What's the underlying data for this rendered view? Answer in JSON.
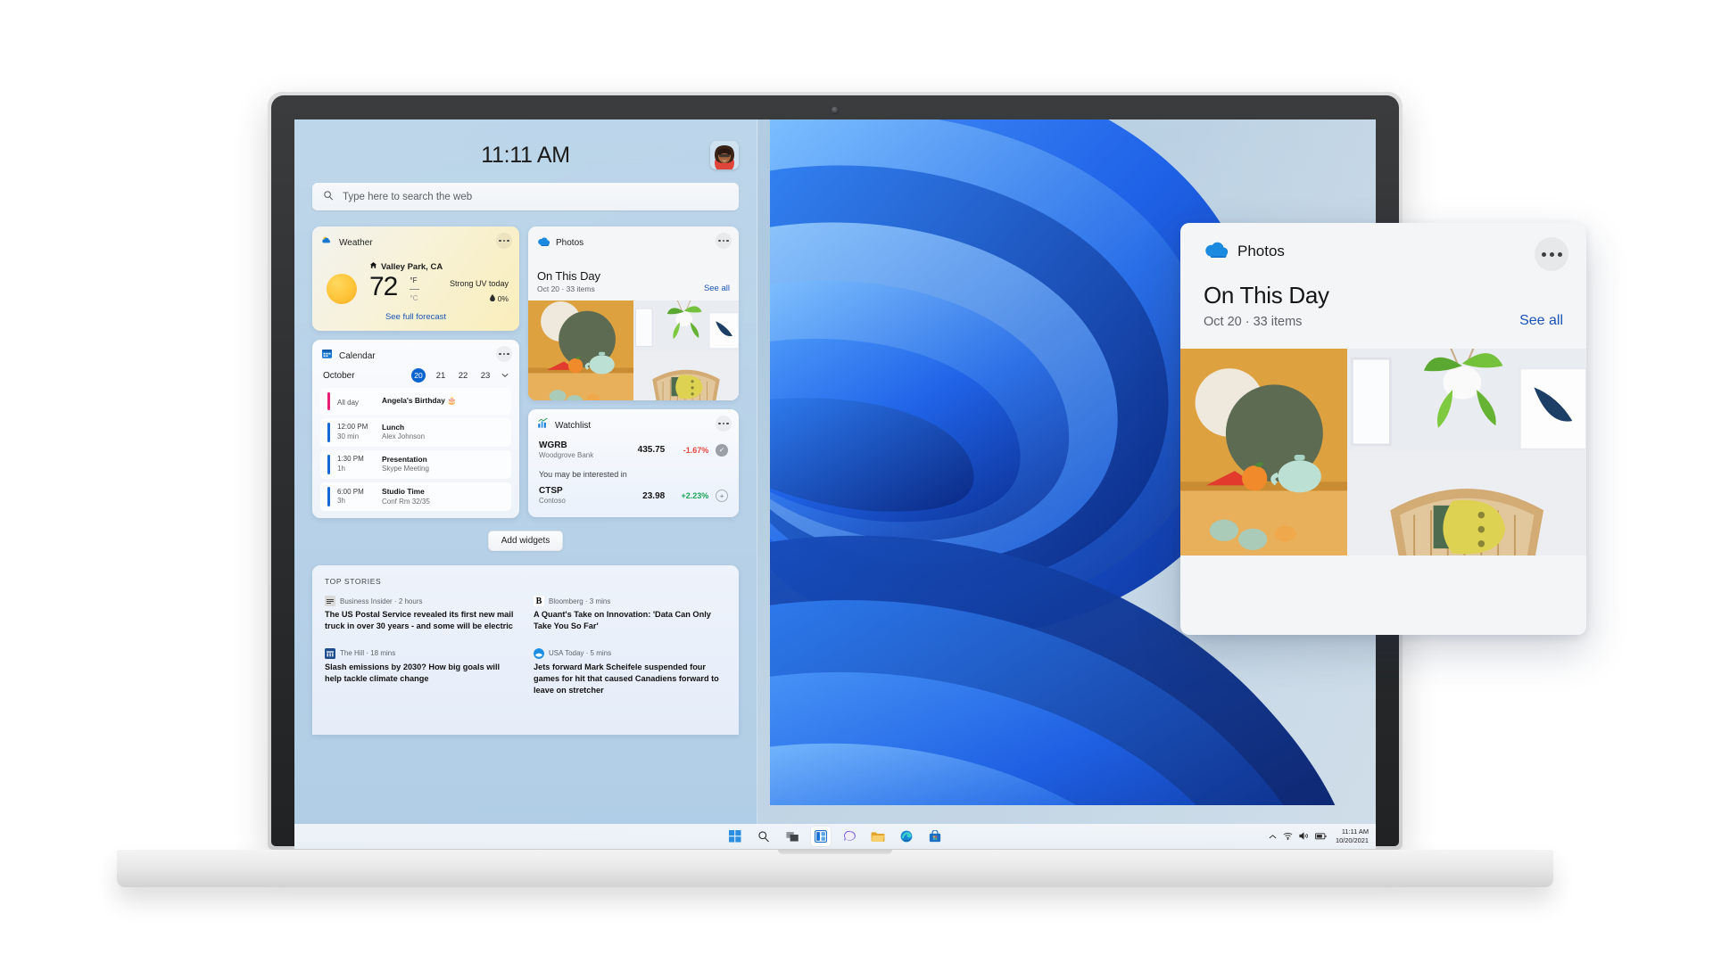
{
  "device": {
    "type": "laptop",
    "webcam": "webcam-dot"
  },
  "widgets_board": {
    "clock": "11:11 AM",
    "avatar_name": "user-avatar",
    "search": {
      "placeholder": "Type here to search the web",
      "icon": "search-icon"
    },
    "add_widgets_label": "Add widgets",
    "weather": {
      "title": "Weather",
      "icon": "partly-cloudy-icon",
      "location": "Valley Park, CA",
      "location_icon": "home-icon",
      "temperature": "72",
      "unit_f": "°F",
      "unit_c": "°C",
      "uv_text": "Strong UV today",
      "precip_icon": "droplet-icon",
      "precip": "0%",
      "link": "See full forecast",
      "more_icon": "more-options-icon"
    },
    "calendar": {
      "title": "Calendar",
      "icon": "calendar-icon",
      "month": "October",
      "days": [
        "20",
        "21",
        "22",
        "23"
      ],
      "selected_day": "20",
      "chevron_icon": "chevron-down-icon",
      "more_icon": "more-options-icon",
      "events": [
        {
          "time": "All day",
          "duration": "",
          "title": "Angela's Birthday",
          "subtitle": "",
          "emoji": "🎂",
          "color": "#e81f76"
        },
        {
          "time": "12:00 PM",
          "duration": "30 min",
          "title": "Lunch",
          "subtitle": "Alex Johnson",
          "emoji": "",
          "color": "#1668d6"
        },
        {
          "time": "1:30 PM",
          "duration": "1h",
          "title": "Presentation",
          "subtitle": "Skype Meeting",
          "emoji": "",
          "color": "#1668d6"
        },
        {
          "time": "6:00 PM",
          "duration": "3h",
          "title": "Studio Time",
          "subtitle": "Conf Rm 32/35",
          "emoji": "",
          "color": "#1668d6"
        }
      ]
    },
    "photos": {
      "title": "Photos",
      "icon": "onedrive-cloud-icon",
      "headline": "On This Day",
      "meta": "Oct 20 · 33 items",
      "see_all": "See all",
      "more_icon": "more-options-icon"
    },
    "watchlist": {
      "title": "Watchlist",
      "icon": "stocks-chart-icon",
      "more_icon": "more-options-icon",
      "note": "You may be interested in",
      "rows": [
        {
          "symbol": "WGRB",
          "company": "Woodgrove Bank",
          "price": "435.75",
          "change": "-1.67%",
          "change_color": "#e8473f",
          "action_icon": "check-icon",
          "action_state": "added"
        },
        {
          "symbol": "CTSP",
          "company": "Contoso",
          "price": "23.98",
          "change": "+2.23%",
          "change_color": "#18a558",
          "action_icon": "plus-icon",
          "action_state": "add"
        }
      ]
    },
    "top_stories": {
      "label": "TOP STORIES",
      "items": [
        {
          "source": "Business Insider",
          "time": "2 hours",
          "logo": "business-insider-logo",
          "logo_bg": "#d8d8d8",
          "logo_text": "BI",
          "headline": "The US Postal Service revealed its first new mail truck in over 30 years - and some will be electric",
          "column": 0
        },
        {
          "source": "The Hill",
          "time": "18 mins",
          "logo": "the-hill-logo",
          "logo_bg": "#1f4d8f",
          "logo_text": "TH",
          "headline": "Slash emissions by 2030? How big goals will help tackle climate change",
          "column": 0
        },
        {
          "source": "Bloomberg",
          "time": "3 mins",
          "logo": "bloomberg-logo",
          "logo_bg": "#ffffff",
          "logo_text": "B",
          "headline": "A Quant's Take on Innovation: 'Data Can Only Take You So Far'",
          "column": 1
        },
        {
          "source": "USA Today",
          "time": "5 mins",
          "logo": "usa-today-logo",
          "logo_bg": "#1a8fe3",
          "logo_text": "U",
          "headline": "Jets forward Mark Scheifele suspended four games for hit that caused Canadiens forward to leave on stretcher",
          "column": 1
        }
      ]
    }
  },
  "taskbar": {
    "buttons": [
      {
        "name": "start-button",
        "icon": "windows-logo-icon",
        "active": false
      },
      {
        "name": "search-button",
        "icon": "search-icon",
        "active": false
      },
      {
        "name": "task-view-button",
        "icon": "task-view-icon",
        "active": false
      },
      {
        "name": "widgets-button",
        "icon": "widgets-icon",
        "active": true
      },
      {
        "name": "chat-button",
        "icon": "chat-bubble-icon",
        "active": false
      },
      {
        "name": "file-explorer-button",
        "icon": "folder-icon",
        "active": false
      },
      {
        "name": "edge-button",
        "icon": "edge-browser-icon",
        "active": false
      },
      {
        "name": "store-button",
        "icon": "microsoft-store-icon",
        "active": false
      }
    ],
    "tray": {
      "chevron_icon": "chevron-up-icon",
      "wifi_icon": "wifi-icon",
      "volume_icon": "speaker-icon",
      "battery_icon": "battery-icon",
      "time": "11:11 AM",
      "date": "10/20/2021"
    }
  },
  "photos_popup": {
    "brand": "Photos",
    "brand_icon": "onedrive-cloud-icon",
    "more_icon": "more-options-icon",
    "headline": "On This Day",
    "meta": "Oct 20 · 33 items",
    "see_all": "See all",
    "photos": [
      {
        "name": "tea-still-life-photo",
        "description": "Teapot and oranges on ochre backdrop"
      },
      {
        "name": "hanging-plant-photo",
        "description": "Hanging pothos plant on white wall"
      },
      {
        "name": "rattan-chair-photo",
        "description": "Rattan chair with yellow cushion"
      }
    ]
  },
  "colors": {
    "accent_blue": "#1a54b8",
    "selected_day": "#0b63ce",
    "stock_down": "#e8473f",
    "stock_up": "#18a558",
    "birthday_bar": "#e81f76"
  }
}
